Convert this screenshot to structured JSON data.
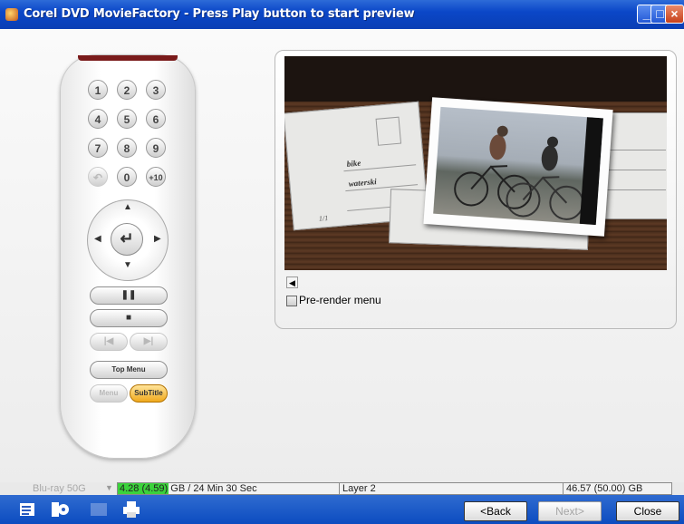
{
  "window": {
    "title": "Corel DVD MovieFactory - Press Play button to start preview",
    "buttons": [
      "minimize",
      "maximize",
      "close"
    ]
  },
  "remote": {
    "numbers": [
      "1",
      "2",
      "3",
      "4",
      "5",
      "6",
      "7",
      "8",
      "9",
      "0",
      "+10"
    ],
    "return_icon": "return-icon",
    "enter_icon": "enter-icon",
    "pause_icon": "pause-icon",
    "stop_icon": "stop-icon",
    "prev_icon": "previous-icon",
    "next_icon": "next-icon",
    "top_menu_label": "Top Menu",
    "menu_label": "Menu",
    "subtitle_label": "SubTitle"
  },
  "preview": {
    "card_text1": "bike",
    "card_text2": "waterski",
    "card_text3": "1/1",
    "speaker_icon": "speaker-icon",
    "prerender_label": "Pre-render menu",
    "prerender_checked": false
  },
  "status": {
    "disc_type": "Blu-ray 50G",
    "used": "4.28 (4.59) GB / 24 Min 30 Sec",
    "layer": "Layer 2",
    "total": "46.57 (50.00) GB",
    "used_fraction": 0.092,
    "colors": {
      "used": "#3bd23b",
      "reserved": "#9de89d"
    }
  },
  "toolbar": {
    "icons": [
      "settings-list-icon",
      "project-settings-icon",
      "disc-image-icon",
      "print-icon"
    ],
    "back_label": "<Back",
    "next_label": "Next>",
    "close_label": "Close"
  }
}
